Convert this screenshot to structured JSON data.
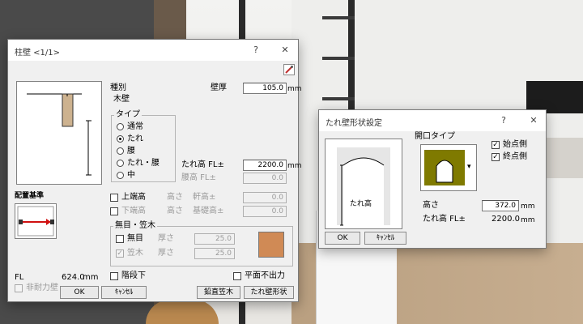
{
  "main_dialog": {
    "title": "柱壁 <1/1>",
    "help": "?",
    "close": "✕",
    "pick_icon": "eyedropper-icon",
    "type_label": "種別",
    "type_value": "木壁",
    "thickness_label": "壁厚",
    "thickness_value": "105.0",
    "thickness_unit": "mm",
    "style_group_label": "タイプ",
    "style_options": [
      {
        "label": "通常",
        "checked": false
      },
      {
        "label": "たれ",
        "checked": true
      },
      {
        "label": "腰",
        "checked": false
      },
      {
        "label": "たれ・腰",
        "checked": false
      },
      {
        "label": "中",
        "checked": false
      }
    ],
    "tare_height_label": "たれ高 FL±",
    "tare_height_value": "2200.0",
    "tare_height_unit": "mm",
    "koshi_height_label": "腰高 FL±",
    "koshi_height_value": "0.0",
    "upper_end_label": "上端高",
    "upper_end_height": "高さ",
    "upper_end_ref": "軒高±",
    "upper_end_value": "0.0",
    "lower_end_label": "下端高",
    "lower_end_height": "高さ",
    "lower_end_ref": "基礎高±",
    "lower_end_value": "0.0",
    "placement_label": "配置基準",
    "fl_label": "FL",
    "fl_value": "624.0",
    "fl_unit": "mm",
    "non_bearing_label": "非耐力壁",
    "group2_label": "無目・笠木",
    "mume_label": "無目",
    "mume_thickness_label": "厚さ",
    "mume_value": "25.0",
    "kasagi_label": "笠木",
    "kasagi_checked": true,
    "kasagi_thickness_label": "厚さ",
    "kasagi_value": "25.0",
    "color_swatch": "#d08a55",
    "below_stair_label": "階段下",
    "no_plane_output_label": "平面不出力",
    "ok": "OK",
    "cancel": "ｷｬﾝｾﾙ",
    "vertical_kasagi": "鉛直笠木",
    "tare_shape_button": "たれ壁形状"
  },
  "shape_dialog": {
    "title": "たれ壁形状設定",
    "help": "?",
    "close": "✕",
    "preview_label": "たれ高",
    "opening_type_label": "開口タイプ",
    "opening_fill": "#7f7a00",
    "start_side_label": "始点側",
    "start_side_checked": true,
    "end_side_label": "終点側",
    "end_side_checked": true,
    "height_label": "高さ",
    "height_value": "372.0",
    "height_unit": "mm",
    "tare_fl_label": "たれ高 FL±",
    "tare_fl_value": "2200.0",
    "tare_fl_unit": "mm",
    "ok": "OK",
    "cancel": "ｷｬﾝｾﾙ"
  }
}
